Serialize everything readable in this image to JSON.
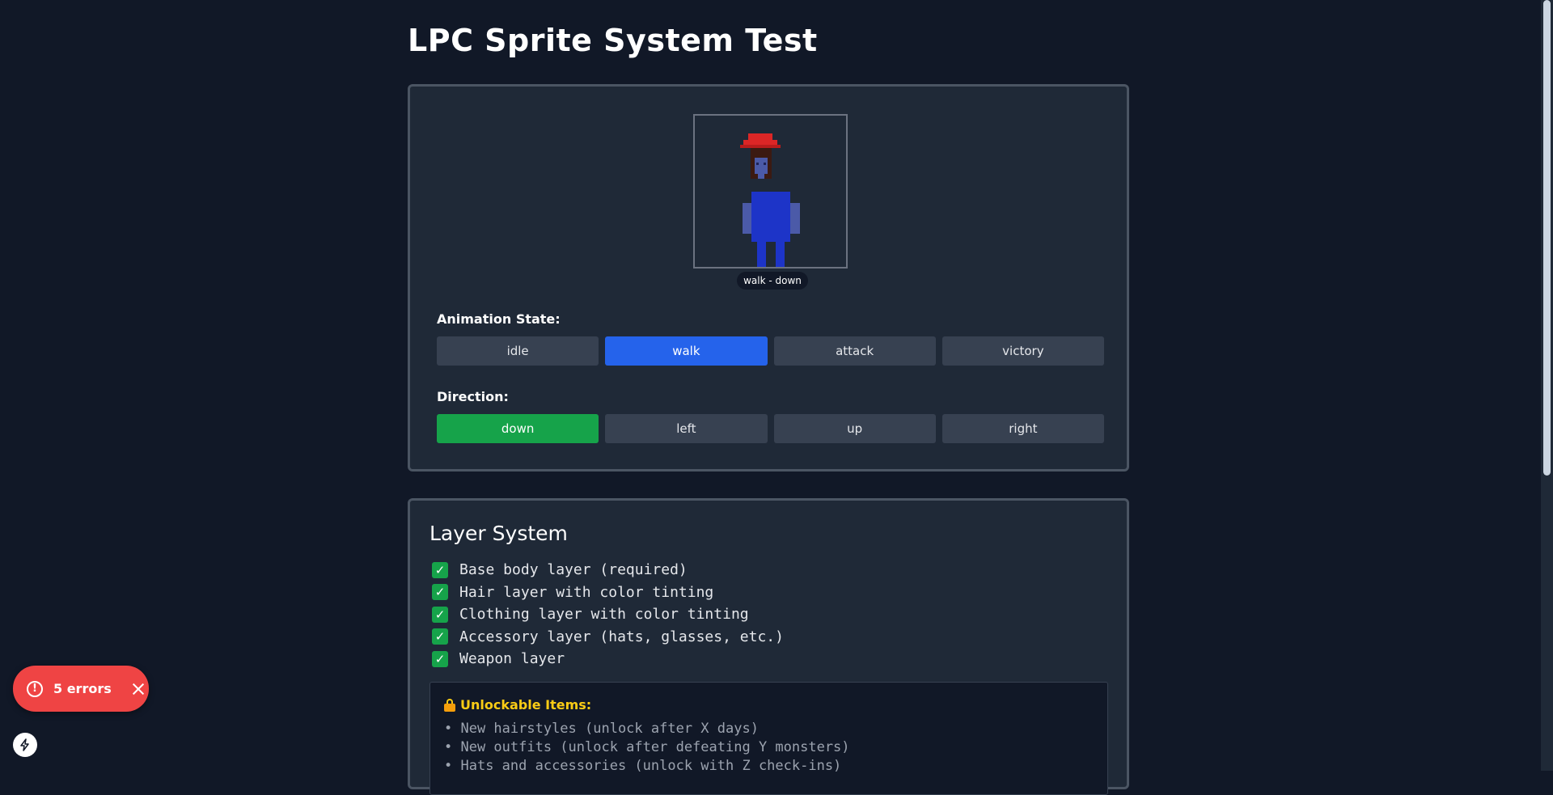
{
  "page": {
    "title": "LPC Sprite System Test"
  },
  "preview": {
    "label": "walk - down"
  },
  "animation": {
    "label": "Animation State:",
    "options": [
      "idle",
      "walk",
      "attack",
      "victory"
    ],
    "selected": "walk"
  },
  "direction": {
    "label": "Direction:",
    "options": [
      "down",
      "left",
      "up",
      "right"
    ],
    "selected": "down"
  },
  "layers": {
    "title": "Layer System",
    "items": [
      "Base body layer (required)",
      "Hair layer with color tinting",
      "Clothing layer with color tinting",
      "Accessory layer (hats, glasses, etc.)",
      "Weapon layer"
    ],
    "check_glyph": "✓"
  },
  "unlockables": {
    "title": "Unlockable Items:",
    "items": [
      "New hairstyles (unlock after X days)",
      "New outfits (unlock after defeating Y monsters)",
      "Hats and accessories (unlock with Z check-ins)"
    ]
  },
  "toast": {
    "text": "5 errors",
    "icon": "!"
  },
  "colors": {
    "background": "#111827",
    "panel": "#1f2937",
    "active_blue": "#2563eb",
    "active_green": "#16a34a",
    "error": "#ef4444",
    "highlight": "#facc15"
  }
}
